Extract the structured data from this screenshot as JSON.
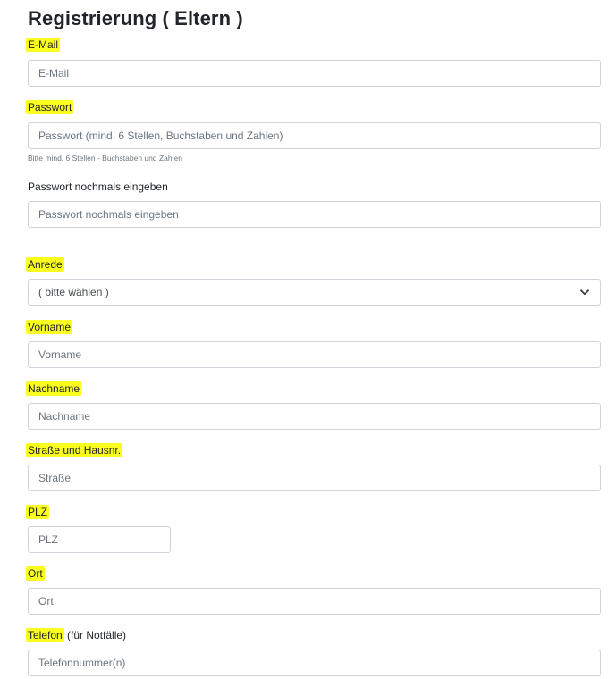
{
  "title": "Registrierung ( Eltern )",
  "email": {
    "label": "E-Mail",
    "placeholder": "E-Mail"
  },
  "password": {
    "label": "Passwort",
    "placeholder": "Passwort (mind. 6 Stellen, Buchstaben und Zahlen)",
    "hint": "Bitte mind. 6 Stellen - Buchstaben und Zahlen"
  },
  "password_repeat": {
    "label": "Passwort nochmals eingeben",
    "placeholder": "Passwort nochmals eingeben"
  },
  "salutation": {
    "label": "Anrede",
    "selected": "( bitte wählen )"
  },
  "firstname": {
    "label": "Vorname",
    "placeholder": "Vorname"
  },
  "lastname": {
    "label": "Nachname",
    "placeholder": "Nachname"
  },
  "street": {
    "label": "Straße und Hausnr.",
    "placeholder": "Straße"
  },
  "zip": {
    "label": "PLZ",
    "placeholder": "PLZ"
  },
  "city": {
    "label": "Ort",
    "placeholder": "Ort"
  },
  "phone": {
    "label": "Telefon",
    "label_suffix": " (für Notfälle)",
    "placeholder": "Telefonnummer(n)"
  },
  "colors": {
    "highlight": "#fbff1e",
    "border": "#ced4da",
    "text": "#212529",
    "placeholder": "#6c757d"
  },
  "icons": {
    "select_arrow": "chevron-down-icon"
  }
}
